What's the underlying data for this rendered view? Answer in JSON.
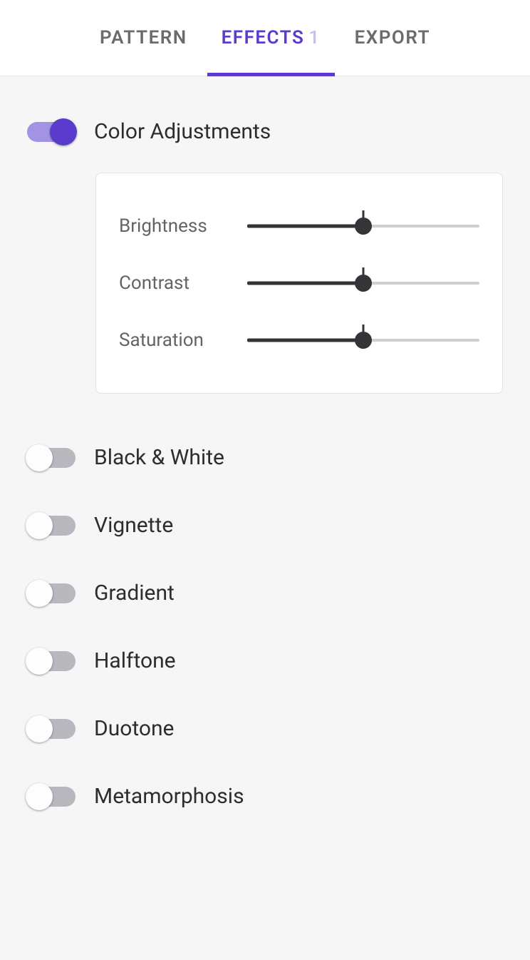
{
  "tabs": {
    "pattern": "PATTERN",
    "effects": "EFFECTS",
    "effects_count": "1",
    "export": "EXPORT"
  },
  "effects": {
    "color_adjustments": {
      "label": "Color Adjustments",
      "enabled": true,
      "controls": {
        "brightness": {
          "label": "Brightness",
          "percent": 50
        },
        "contrast": {
          "label": "Contrast",
          "percent": 50
        },
        "saturation": {
          "label": "Saturation",
          "percent": 50
        }
      }
    },
    "black_white": {
      "label": "Black & White",
      "enabled": false
    },
    "vignette": {
      "label": "Vignette",
      "enabled": false
    },
    "gradient": {
      "label": "Gradient",
      "enabled": false
    },
    "halftone": {
      "label": "Halftone",
      "enabled": false
    },
    "duotone": {
      "label": "Duotone",
      "enabled": false
    },
    "metamorphosis": {
      "label": "Metamorphosis",
      "enabled": false
    }
  }
}
